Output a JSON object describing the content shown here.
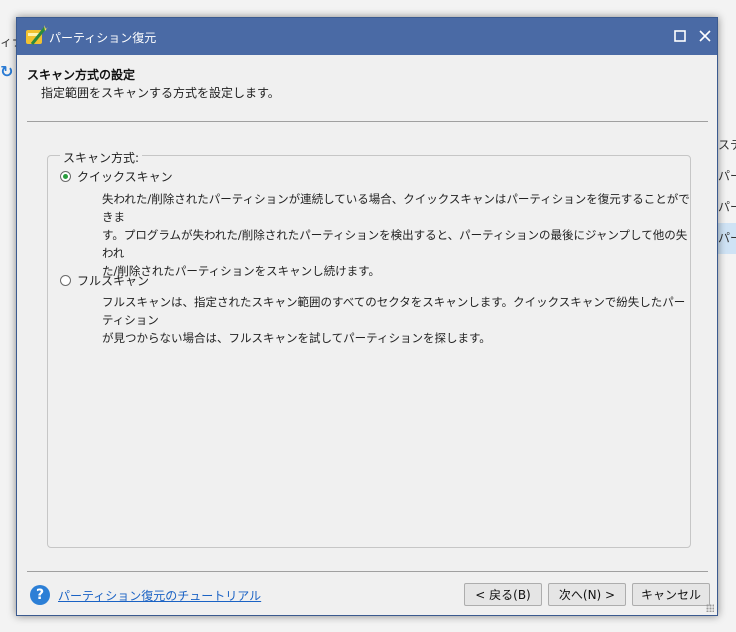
{
  "background": {
    "left_text": "ィナ",
    "right_items": [
      "ステ",
      "パー",
      "パー",
      "パー"
    ]
  },
  "dialog": {
    "title": "パーティション復元",
    "header": {
      "title": "スキャン方式の設定",
      "subtitle": "指定範囲をスキャンする方式を設定します。"
    },
    "group_label": "スキャン方式:",
    "options": [
      {
        "label": "クイックスキャン",
        "checked": true,
        "description_lines": [
          "失われた/削除されたパーティションが連続している場合、クイックスキャンはパーティションを復元することができま",
          "す。プログラムが失われた/削除されたパーティションを検出すると、パーティションの最後にジャンプして他の失われ",
          "た/削除されたパーティションをスキャンし続けます。"
        ]
      },
      {
        "label": "フルスキャン",
        "checked": false,
        "description_lines": [
          "フルスキャンは、指定されたスキャン範囲のすべてのセクタをスキャンします。クイックスキャンで紛失したパーティション",
          "が見つからない場合は、フルスキャンを試してパーティションを探します。"
        ]
      }
    ],
    "help_link": "パーティション復元のチュートリアル",
    "buttons": {
      "back": "< 戻る(B)",
      "next": "次へ(N) >",
      "cancel": "キャンセル"
    },
    "icons": {
      "help": "help-icon",
      "maximize": "maximize-icon",
      "close": "close-icon"
    },
    "colors": {
      "titlebar": "#4a6aa5",
      "link": "#1a62c4",
      "radio_checked": "#2a9d3e"
    }
  }
}
